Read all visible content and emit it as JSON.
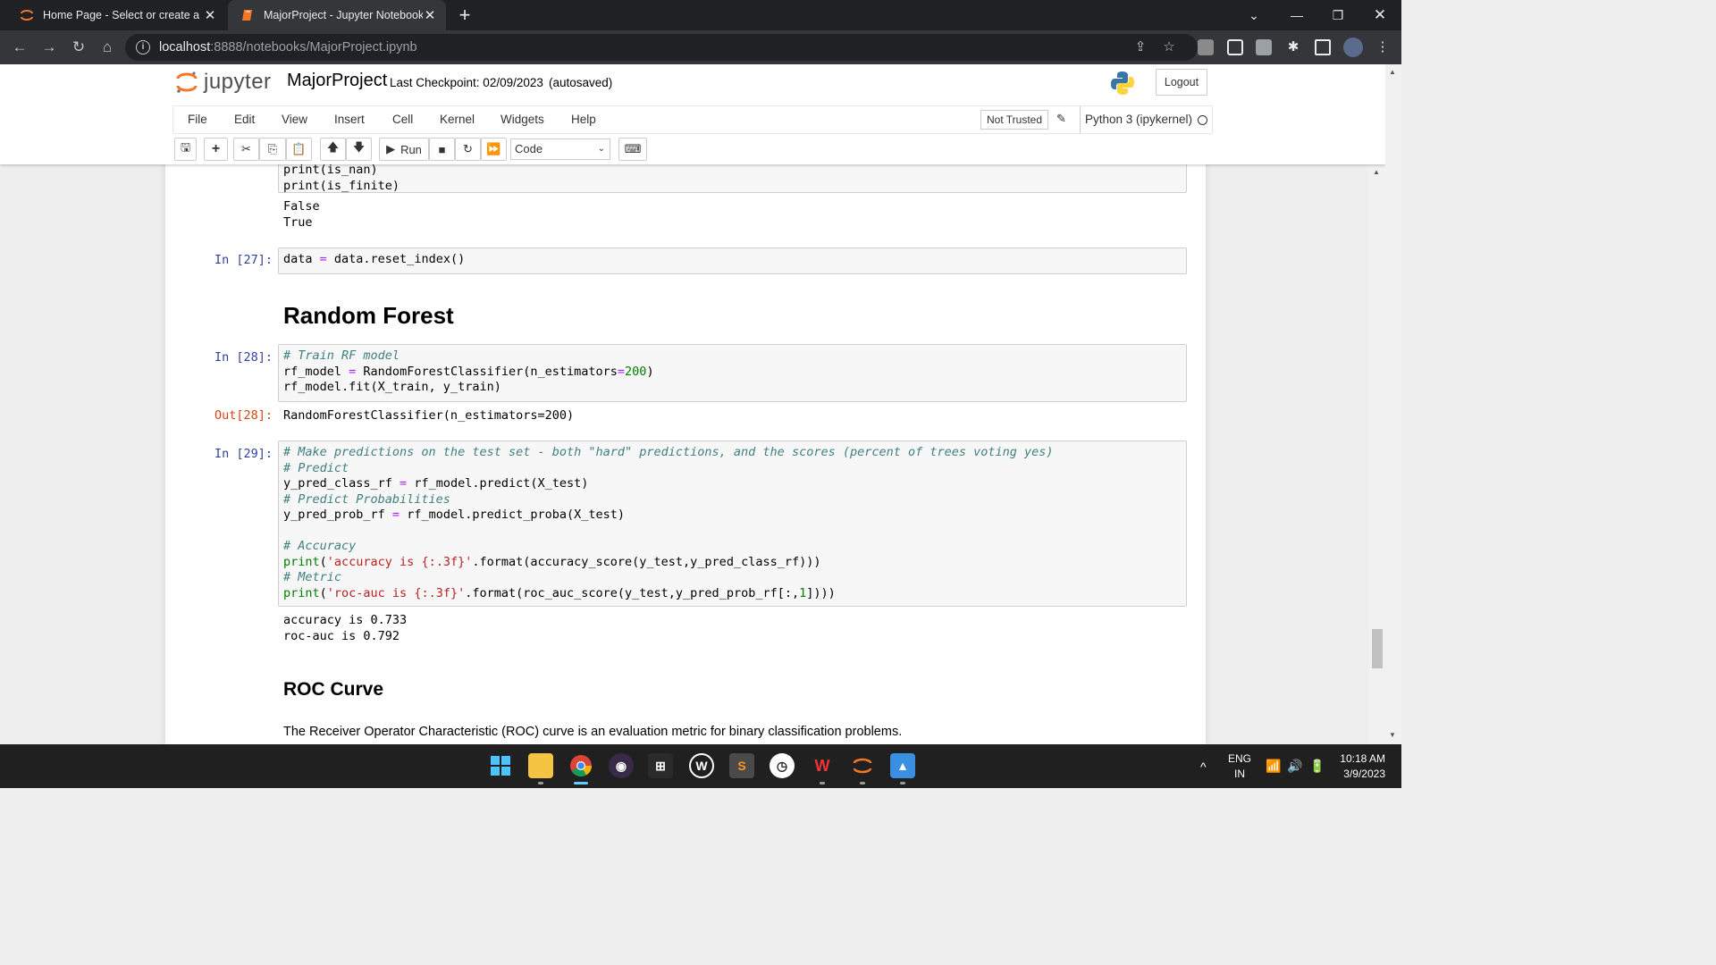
{
  "browser": {
    "tabs": [
      {
        "title": "Home Page - Select or create a n",
        "active": false
      },
      {
        "title": "MajorProject - Jupyter Notebook",
        "active": true
      }
    ],
    "new_tab": "+",
    "url_host": "localhost",
    "url_rest": ":8888/notebooks/MajorProject.ipynb"
  },
  "jupyter": {
    "logo_text": "jupyter",
    "notebook_name": "MajorProject",
    "checkpoint": "Last Checkpoint: 02/09/2023",
    "autosaved": "(autosaved)",
    "logout_label": "Logout",
    "menu": [
      "File",
      "Edit",
      "View",
      "Insert",
      "Cell",
      "Kernel",
      "Widgets",
      "Help"
    ],
    "trust_label": "Not Trusted",
    "kernel_label": "Python 3 (ipykernel)",
    "run_label": "Run",
    "cell_type": "Code"
  },
  "cells": {
    "c26": {
      "line1": "print(is_nan)",
      "line2": "print(is_finite)",
      "output": "False\nTrue"
    },
    "c27": {
      "prompt": "In [27]:",
      "code": "data = data.reset_index()"
    },
    "md_rf": "Random Forest",
    "c28": {
      "prompt": "In [28]:",
      "out_prompt": "Out[28]:",
      "comment": "# Train RF model",
      "output": "RandomForestClassifier(n_estimators=200)"
    },
    "c29": {
      "prompt": "In [29]:",
      "comment1": "# Make predictions on the test set - both \"hard\" predictions, and the scores (percent of trees voting yes)",
      "comment2": "# Predict",
      "comment3": "# Predict Probabilities",
      "comment4": "# Accuracy",
      "comment5": "# Metric",
      "output": "accuracy is 0.733\nroc-auc is 0.792"
    },
    "md_roc_title": "ROC Curve",
    "md_roc_text": "The Receiver Operator Characteristic (ROC) curve is an evaluation metric for binary classification problems."
  },
  "taskbar": {
    "lang1": "ENG",
    "lang2": "IN",
    "time": "10:18 AM",
    "date": "3/9/2023"
  },
  "colors": {
    "prompt_in": "#303f9f",
    "prompt_out": "#d84315",
    "comment": "#408080",
    "operator": "#aa22ff",
    "number": "#008000",
    "string": "#ba2121"
  }
}
